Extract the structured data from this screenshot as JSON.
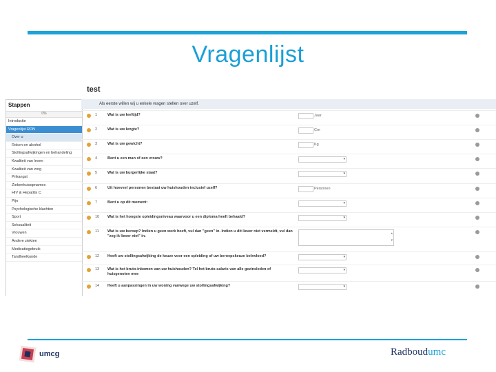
{
  "slide": {
    "title": "Vragenlijst",
    "colors": {
      "accent": "#1aa3d9",
      "brand_dark": "#1b2f5e"
    }
  },
  "app": {
    "page_title": "test",
    "sidebar": {
      "header": "Stappen",
      "subheader": "0%",
      "items": [
        {
          "label": "Introductie",
          "state": "normal",
          "indent": false
        },
        {
          "label": "Vragenlijst RDN",
          "state": "active",
          "indent": false
        },
        {
          "label": "Over u",
          "state": "selected",
          "indent": true
        },
        {
          "label": "Roken en alcohol",
          "state": "normal",
          "indent": true
        },
        {
          "label": "Stollingsafwijkingen en behandeling",
          "state": "normal",
          "indent": true
        },
        {
          "label": "Kwaliteit van leven",
          "state": "normal",
          "indent": true
        },
        {
          "label": "Kwaliteit van zorg",
          "state": "normal",
          "indent": true
        },
        {
          "label": "Prikangst",
          "state": "normal",
          "indent": true
        },
        {
          "label": "Ziekenhuisopnames",
          "state": "normal",
          "indent": true
        },
        {
          "label": "HIV & Hepatitis C",
          "state": "normal",
          "indent": true
        },
        {
          "label": "Pijn",
          "state": "normal",
          "indent": true
        },
        {
          "label": "Psychologische klachten",
          "state": "normal",
          "indent": true
        },
        {
          "label": "Sport",
          "state": "normal",
          "indent": true
        },
        {
          "label": "Seksualiteit",
          "state": "normal",
          "indent": true
        },
        {
          "label": "Vrouwen",
          "state": "normal",
          "indent": true
        },
        {
          "label": "Andere ziekten",
          "state": "normal",
          "indent": true
        },
        {
          "label": "Medicatiegebruik",
          "state": "normal",
          "indent": true
        },
        {
          "label": "Tandheelkunde",
          "state": "normal",
          "indent": true
        }
      ]
    },
    "intro_text": "Als eerste willen wij u enkele vragen stellen over uzelf.",
    "questions": [
      {
        "num": "1",
        "text": "Wat is uw leeftijd?",
        "input": "text",
        "unit": "Jaar"
      },
      {
        "num": "2",
        "text": "Wat is uw lengte?",
        "input": "text",
        "unit": "Cm"
      },
      {
        "num": "3",
        "text": "Wat is uw gewicht?",
        "input": "text",
        "unit": "Kg"
      },
      {
        "num": "4",
        "text": "Bent u een man of een vrouw?",
        "input": "select",
        "unit": ""
      },
      {
        "num": "5",
        "text": "Wat is uw burgerlijke staat?",
        "input": "select",
        "unit": ""
      },
      {
        "num": "6",
        "text": "Uit hoeveel personen bestaat uw huishouden inclusief uzelf?",
        "input": "text",
        "unit": "Personen"
      },
      {
        "num": "7",
        "text": "Bent u op dit moment:",
        "input": "select",
        "unit": ""
      },
      {
        "num": "10",
        "text": "Wat is het hoogste opleidingsniveau waarvoor u een diploma heeft behaald?",
        "input": "select",
        "unit": ""
      },
      {
        "num": "11",
        "text": "Wat is uw beroep? Indien u geen werk heeft, vul dan \"geen\" in. Indien u dit liever niet vermeldt, vul dan \"zeg ik liever niet\" in.",
        "input": "textarea",
        "unit": ""
      },
      {
        "num": "12",
        "text": "Heeft uw stollingsafwijking de keuze voor een opleiding of uw beroepskeuze beïnvloed?",
        "input": "select",
        "unit": ""
      },
      {
        "num": "13",
        "text": "Wat is het bruto-inkomen van uw huishouden? Tel het bruto-salaris van alle gezinsleden of huisgenoten mee",
        "input": "select",
        "unit": ""
      },
      {
        "num": "14",
        "text": "Heeft u aanpassingen in uw woning vanwege uw stollingsafwijking?",
        "input": "select",
        "unit": ""
      }
    ]
  },
  "footer": {
    "left_logo_text": "umcg",
    "right_logo_main": "Radboud",
    "right_logo_suffix": "umc"
  }
}
